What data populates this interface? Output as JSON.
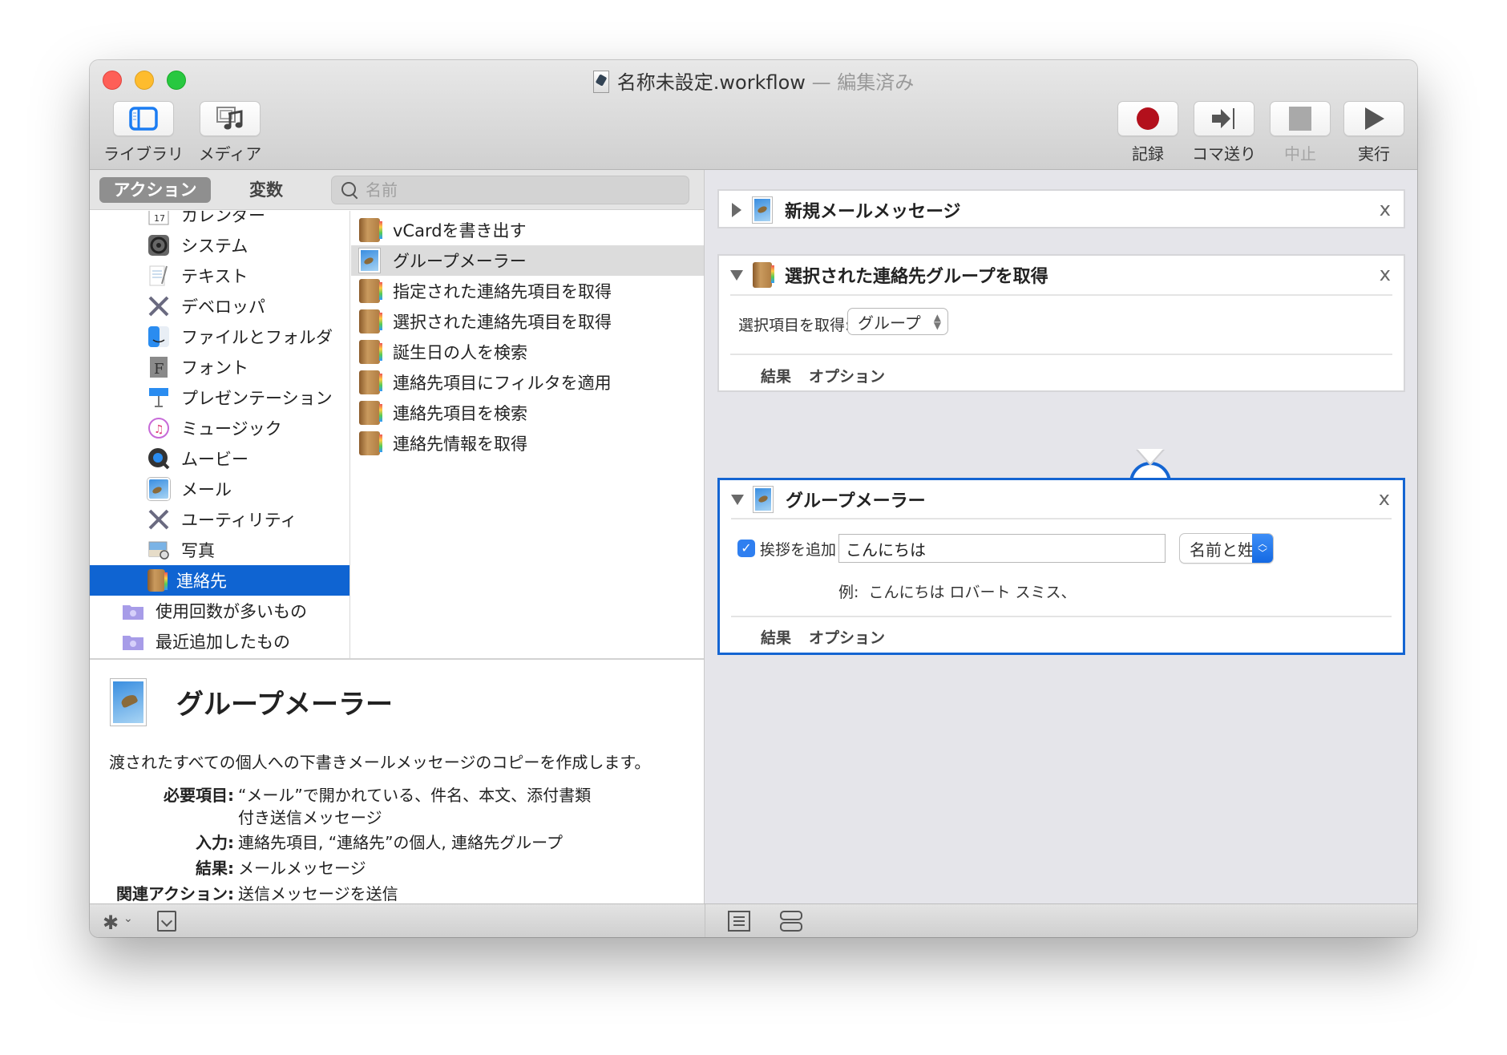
{
  "window": {
    "title": "名称未設定.workflow",
    "title_separator": " — ",
    "edited_label": "編集済み"
  },
  "toolbar": {
    "left": [
      {
        "label": "ライブラリ",
        "icon": "library-icon"
      },
      {
        "label": "メディア",
        "icon": "media-icon"
      }
    ],
    "right": [
      {
        "label": "記録",
        "icon": "record-icon",
        "enabled": true,
        "color": "#b3101c"
      },
      {
        "label": "コマ送り",
        "icon": "step-icon",
        "enabled": true
      },
      {
        "label": "中止",
        "icon": "stop-icon",
        "enabled": false
      },
      {
        "label": "実行",
        "icon": "run-icon",
        "enabled": true
      }
    ]
  },
  "library": {
    "tabs": [
      {
        "label": "アクション",
        "active": true
      },
      {
        "label": "変数",
        "active": false
      }
    ],
    "search": {
      "placeholder": "名前",
      "value": ""
    },
    "categories": [
      {
        "label": "カレンダー",
        "icon": "calendar-icon"
      },
      {
        "label": "システム",
        "icon": "system-icon"
      },
      {
        "label": "テキスト",
        "icon": "text-icon"
      },
      {
        "label": "デベロッパ",
        "icon": "developer-icon"
      },
      {
        "label": "ファイルとフォルダ",
        "icon": "finder-icon"
      },
      {
        "label": "フォント",
        "icon": "font-icon"
      },
      {
        "label": "プレゼンテーション",
        "icon": "keynote-icon"
      },
      {
        "label": "ミュージック",
        "icon": "music-icon"
      },
      {
        "label": "ムービー",
        "icon": "quicktime-icon"
      },
      {
        "label": "メール",
        "icon": "mail-icon"
      },
      {
        "label": "ユーティリティ",
        "icon": "utilities-icon"
      },
      {
        "label": "写真",
        "icon": "photos-icon"
      },
      {
        "label": "連絡先",
        "icon": "contacts-icon",
        "selected": true
      },
      {
        "label": "使用回数が多いもの",
        "icon": "smart-folder-icon",
        "top_level": true
      },
      {
        "label": "最近追加したもの",
        "icon": "smart-folder-icon",
        "top_level": true
      }
    ],
    "actions": [
      {
        "label": "vCardを書き出す",
        "icon": "contacts-icon"
      },
      {
        "label": "グループメーラー",
        "icon": "mail-icon",
        "selected": true
      },
      {
        "label": "指定された連絡先項目を取得",
        "icon": "contacts-icon"
      },
      {
        "label": "選択された連絡先項目を取得",
        "icon": "contacts-icon"
      },
      {
        "label": "誕生日の人を検索",
        "icon": "contacts-icon"
      },
      {
        "label": "連絡先項目にフィルタを適用",
        "icon": "contacts-icon"
      },
      {
        "label": "連絡先項目を検索",
        "icon": "contacts-icon"
      },
      {
        "label": "連絡先情報を取得",
        "icon": "contacts-icon"
      }
    ]
  },
  "description": {
    "title": "グループメーラー",
    "summary": "渡されたすべての個人への下書きメールメッセージのコピーを作成します。",
    "rows": [
      {
        "key": "必要項目:",
        "value": "“メール”で開かれている、件名、本文、添付書類付き送信メッセージ"
      },
      {
        "key": "入力:",
        "value": "連絡先項目, “連絡先”の個人, 連絡先グループ"
      },
      {
        "key": "結果:",
        "value": "メールメッセージ"
      },
      {
        "key": "関連アクション:",
        "value": "送信メッセージを送信"
      }
    ]
  },
  "workflow": {
    "cards": [
      {
        "title": "新規メールメッセージ",
        "expanded": false,
        "icon": "mail-icon"
      },
      {
        "title": "選択された連絡先グループを取得",
        "expanded": true,
        "icon": "contacts-icon",
        "field_label": "選択項目を取得:",
        "select_value": "グループ",
        "footer": [
          "結果",
          "オプション"
        ]
      },
      {
        "title": "グループメーラー",
        "expanded": true,
        "selected": true,
        "icon": "mail-icon",
        "checkbox_label": "挨拶を追加",
        "checkbox_checked": true,
        "greeting_value": "こんにちは",
        "name_format_value": "名前と姓",
        "example_text": "例:  こんにちは ロバート スミス、",
        "footer": [
          "結果",
          "オプション"
        ]
      }
    ],
    "close_glyph": "x"
  },
  "colors": {
    "selection_blue": "#0f64d2",
    "selected_card_border": "#1465d2",
    "record_red": "#b3101c"
  }
}
